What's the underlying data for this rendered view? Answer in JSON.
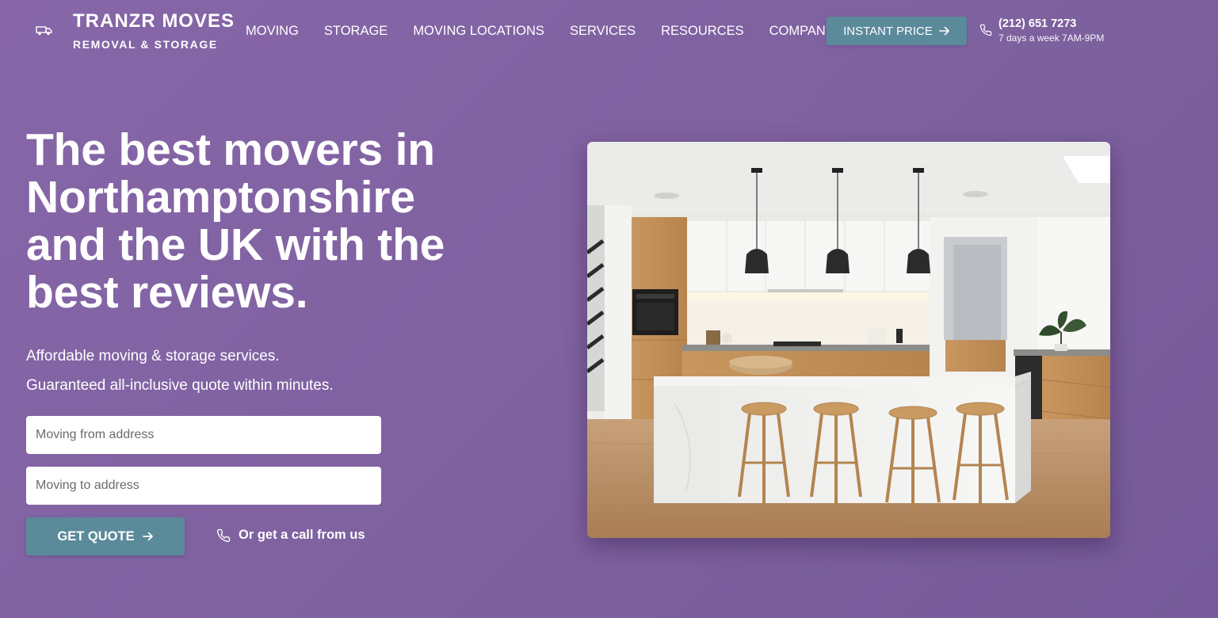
{
  "brand": {
    "name": "TRANZR MOVES",
    "tagline": "REMOVAL & STORAGE",
    "logo_icon": "truck-icon"
  },
  "nav": {
    "items": [
      {
        "label": "MOVING"
      },
      {
        "label": "STORAGE"
      },
      {
        "label": "MOVING LOCATIONS"
      },
      {
        "label": "SERVICES"
      },
      {
        "label": "RESOURCES"
      },
      {
        "label": "COMPANY"
      }
    ],
    "cta_label": "INSTANT PRICE",
    "cta_icon": "arrow-right-icon"
  },
  "contact": {
    "icon": "phone-icon",
    "phone": "(212) 651 7273",
    "hours": "7 days a week 7AM-9PM"
  },
  "hero": {
    "title_lines": [
      "The best movers in",
      "Northamptonshire",
      "and the UK with the",
      "best reviews."
    ],
    "subtitle_lines": [
      "Affordable moving & storage services.",
      "Guaranteed all-inclusive quote within minutes."
    ],
    "from_placeholder": "Moving from address",
    "to_placeholder": "Moving to address",
    "quote_button": "GET QUOTE",
    "call_link": "Or get a call from us",
    "image": "kitchen-interior-photo"
  },
  "colors": {
    "background": "#8264a6",
    "accent_button": "#5b8a9b",
    "text": "#ffffff"
  }
}
